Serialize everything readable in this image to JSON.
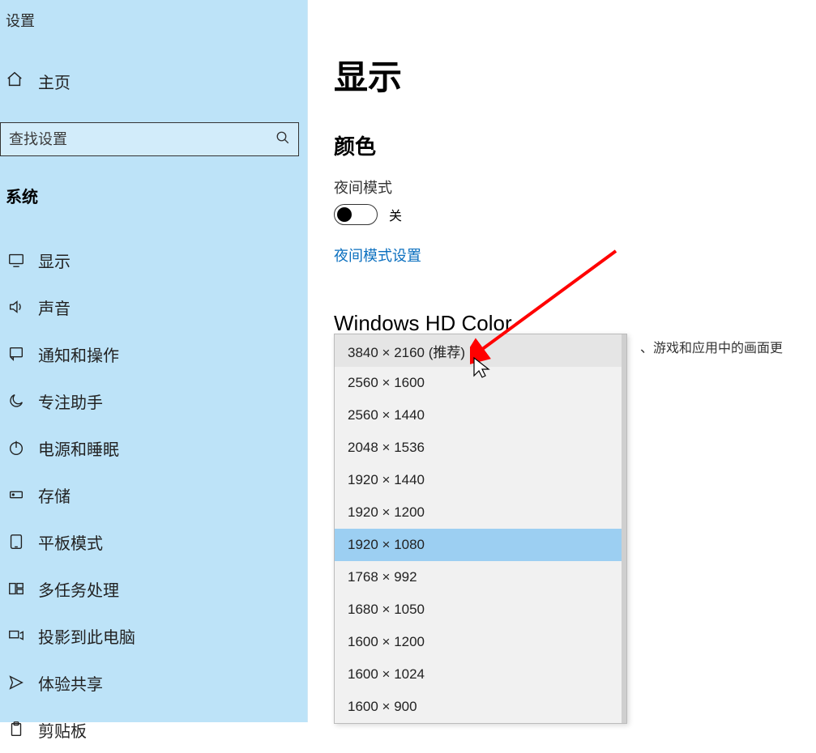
{
  "sidebar": {
    "settings_label": "设置",
    "home_label": "主页",
    "search_placeholder": "查找设置",
    "section_label": "系统",
    "items": [
      {
        "label": "显示"
      },
      {
        "label": "声音"
      },
      {
        "label": "通知和操作"
      },
      {
        "label": "专注助手"
      },
      {
        "label": "电源和睡眠"
      },
      {
        "label": "存储"
      },
      {
        "label": "平板模式"
      },
      {
        "label": "多任务处理"
      },
      {
        "label": "投影到此电脑"
      },
      {
        "label": "体验共享"
      },
      {
        "label": "剪贴板"
      }
    ]
  },
  "main": {
    "title": "显示",
    "color_heading": "颜色",
    "night_mode_label": "夜间模式",
    "night_mode_state": "关",
    "night_mode_settings_link": "夜间模式设置",
    "hd_color_heading": "Windows HD Color",
    "side_desc": "、游戏和应用中的画面更"
  },
  "resolution_dropdown": {
    "options": [
      "3840 × 2160 (推荐)",
      "2560 × 1600",
      "2560 × 1440",
      "2048 × 1536",
      "1920 × 1440",
      "1920 × 1200",
      "1920 × 1080",
      "1768 × 992",
      "1680 × 1050",
      "1600 × 1200",
      "1600 × 1024",
      "1600 × 900"
    ],
    "hover_index": 0,
    "selected_index": 6
  },
  "annotation": {
    "arrow_color": "#ff0000"
  }
}
